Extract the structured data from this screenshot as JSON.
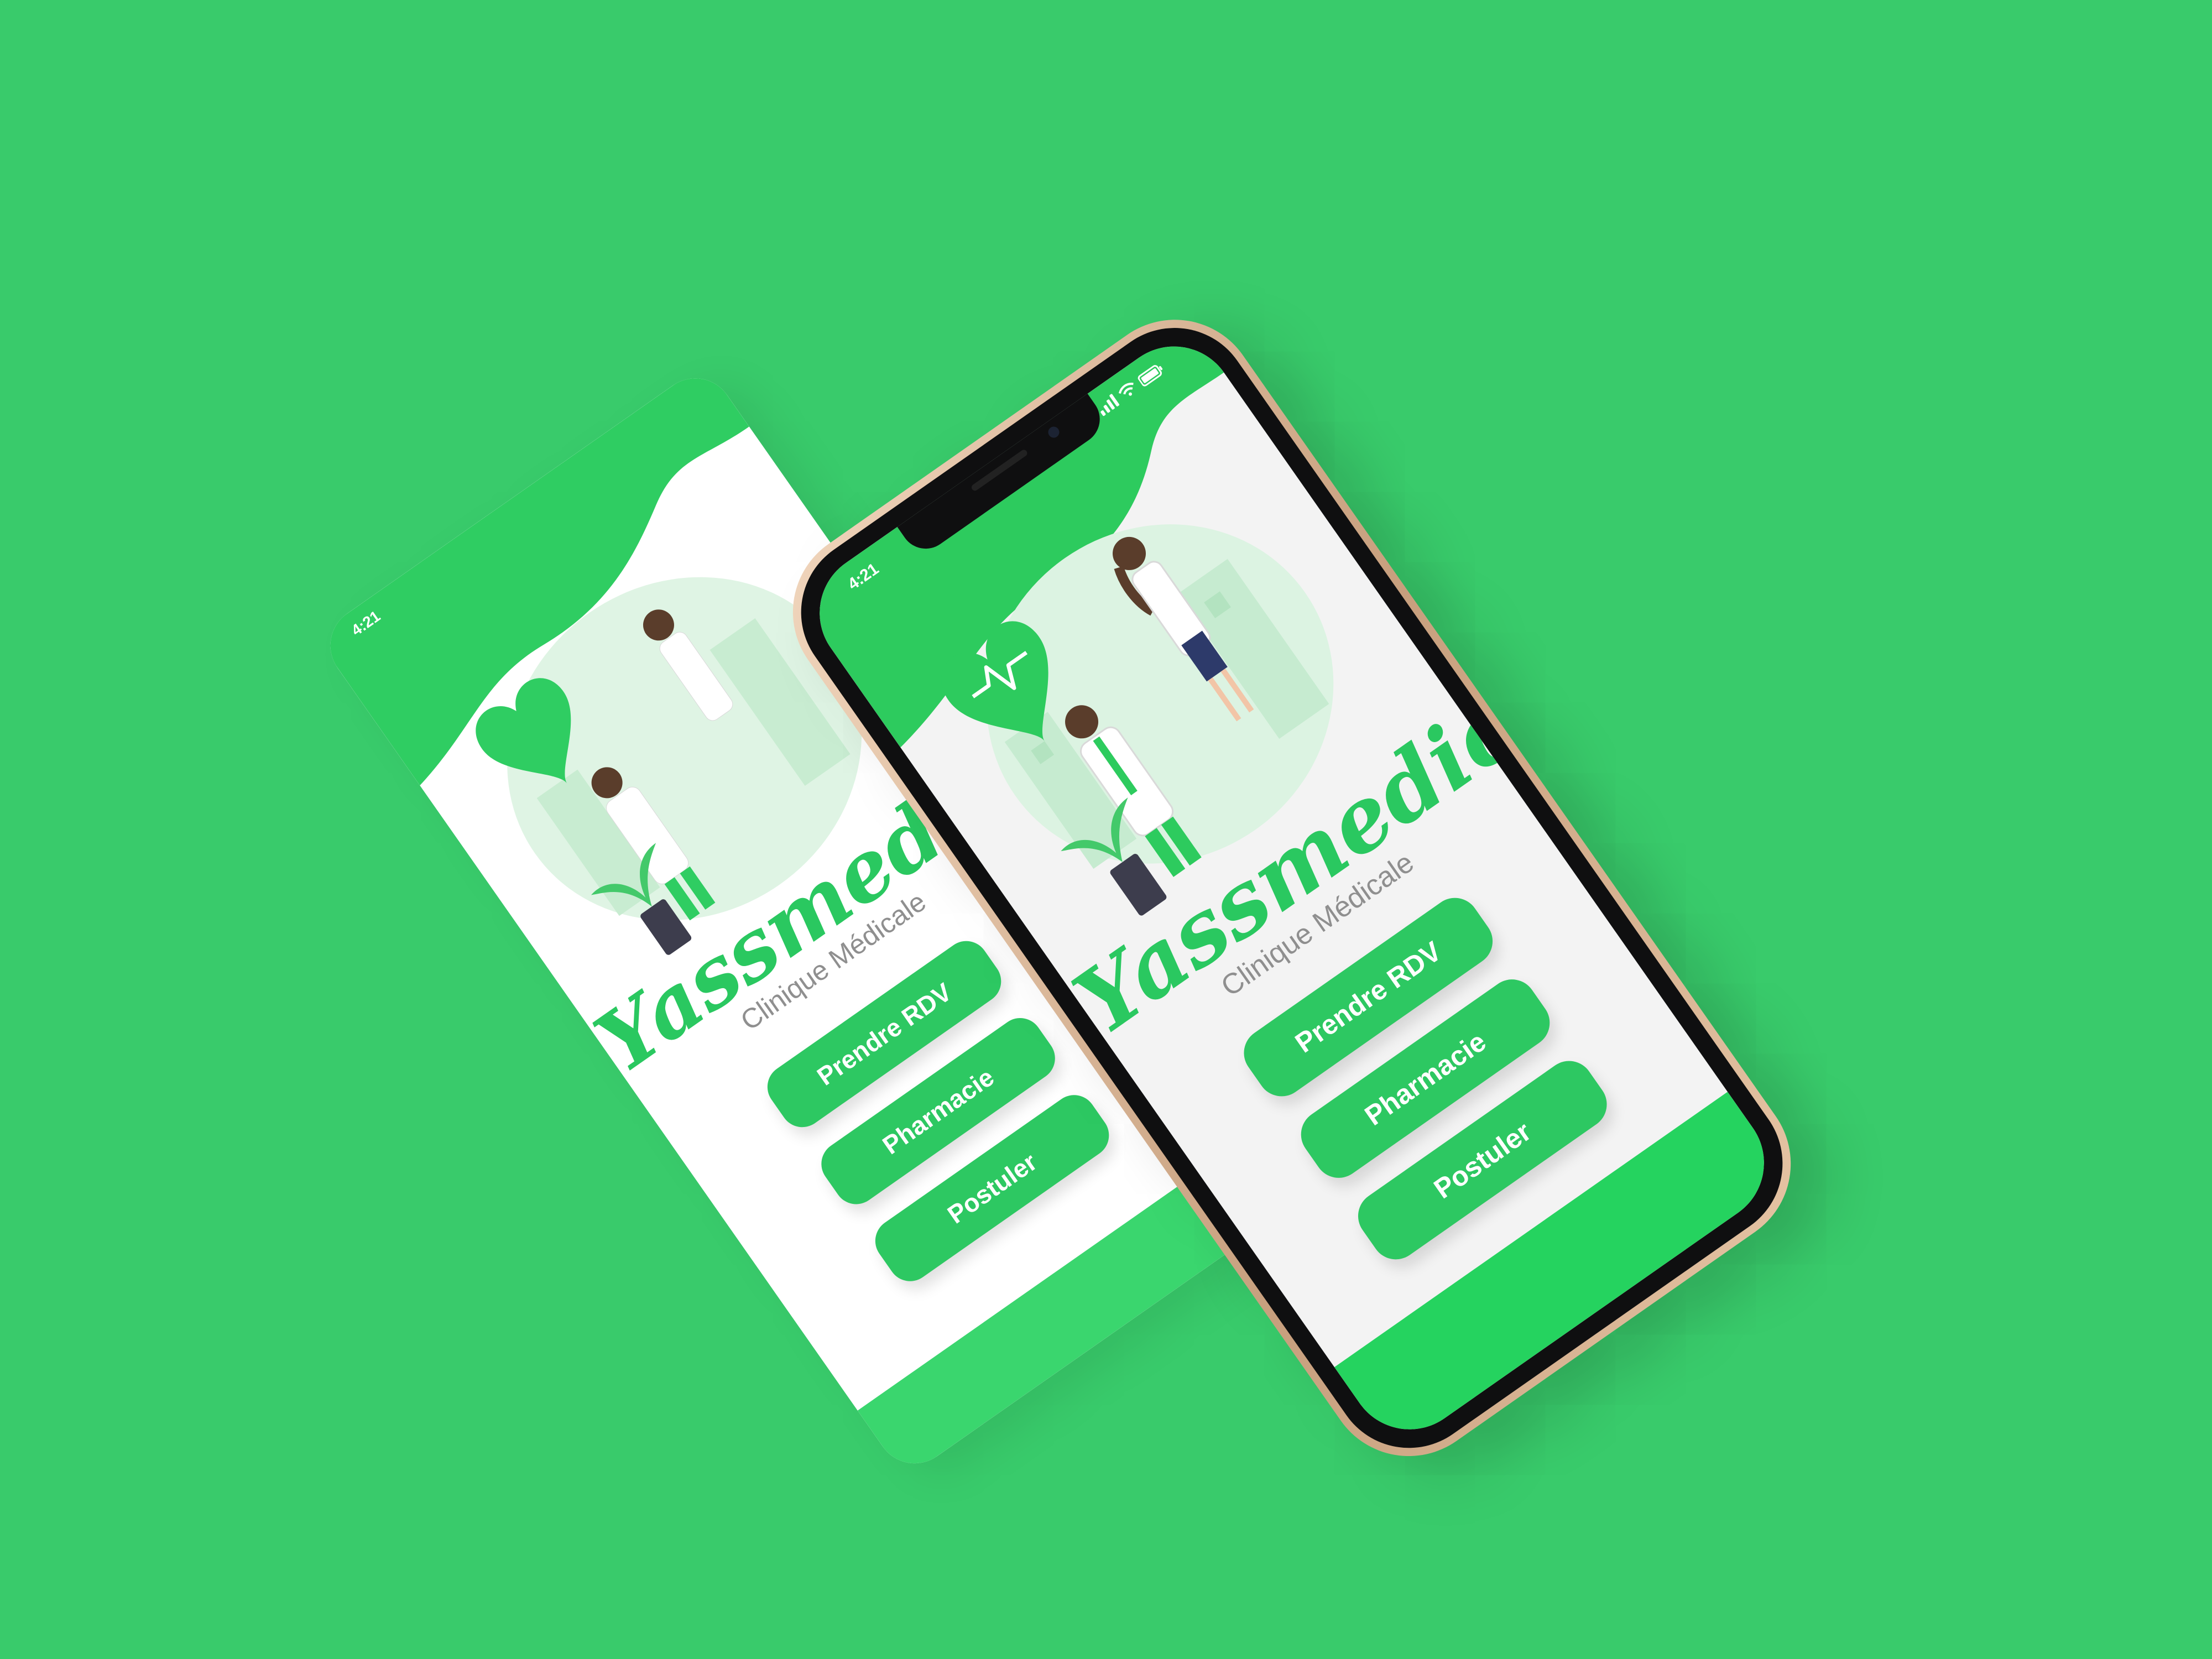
{
  "app": {
    "brand_name": "Yassmedic",
    "tagline": "Clinique Médicale",
    "status_time": "4:21"
  },
  "menu": {
    "buttons": [
      {
        "label": "Prendre RDV"
      },
      {
        "label": "Pharmacie"
      },
      {
        "label": "Postuler"
      }
    ]
  },
  "icons": {
    "heart": "heart-pulse-icon",
    "signal": "signal-bars-icon",
    "wifi": "wifi-icon",
    "battery": "battery-icon"
  },
  "colors": {
    "background": "#39cb6b",
    "accent": "#2dc862",
    "screen": "#f3f3f3",
    "frame": "#d4b08e"
  }
}
